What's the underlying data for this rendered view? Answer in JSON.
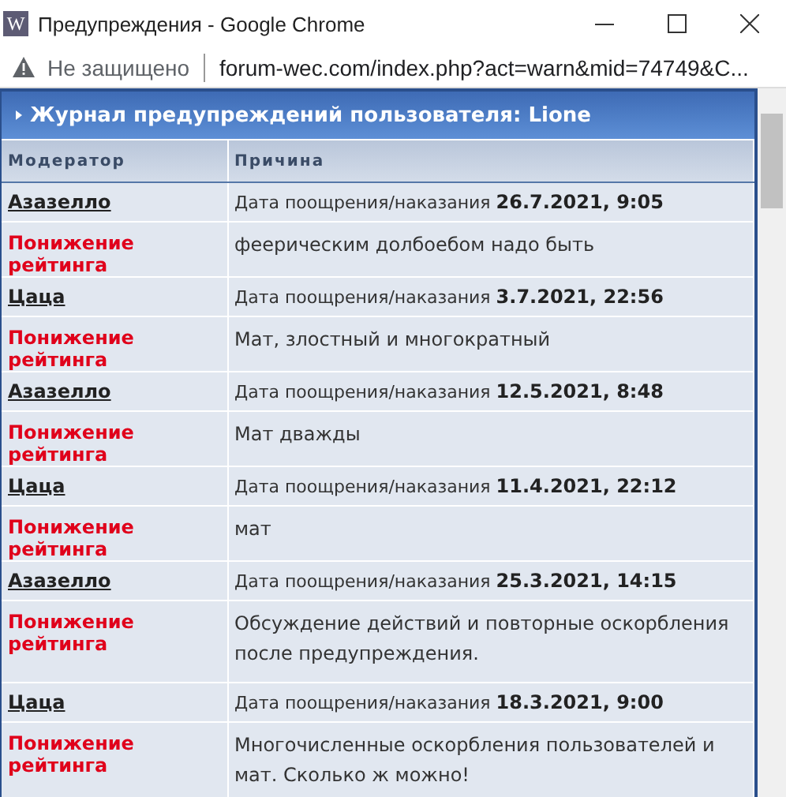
{
  "window": {
    "title": "Предупреждения - Google Chrome",
    "favicon": "W"
  },
  "address_bar": {
    "security": "Не защищено",
    "url": "forum-wec.com/index.php?act=warn&mid=74749&C..."
  },
  "panel": {
    "title": "Журнал предупреждений пользователя: Lione"
  },
  "table": {
    "columns": [
      "Модератор",
      "Причина"
    ],
    "entries": [
      {
        "moderator": "Азазелло",
        "date_label": "Дата поощрения/наказания",
        "date": "26.7.2021, 9:05",
        "action": "Понижение рейтинга",
        "reason": "феерическим долбоебом надо быть"
      },
      {
        "moderator": "Цаца",
        "date_label": "Дата поощрения/наказания",
        "date": "3.7.2021, 22:56",
        "action": "Понижение рейтинга",
        "reason": "Мат, злостный и многократный"
      },
      {
        "moderator": "Азазелло",
        "date_label": "Дата поощрения/наказания",
        "date": "12.5.2021, 8:48",
        "action": "Понижение рейтинга",
        "reason": "Мат дважды"
      },
      {
        "moderator": "Цаца",
        "date_label": "Дата поощрения/наказания",
        "date": "11.4.2021, 22:12",
        "action": "Понижение рейтинга",
        "reason": "мат"
      },
      {
        "moderator": "Азазелло",
        "date_label": "Дата поощрения/наказания",
        "date": "25.3.2021, 14:15",
        "action": "Понижение рейтинга",
        "reason": "Обсуждение действий и повторные оскорбления после предупреждения."
      },
      {
        "moderator": "Цаца",
        "date_label": "Дата поощрения/наказания",
        "date": "18.3.2021, 9:00",
        "action": "Понижение рейтинга",
        "reason": "Многочисленные оскорбления пользователей и мат. Сколько ж можно!"
      }
    ]
  }
}
